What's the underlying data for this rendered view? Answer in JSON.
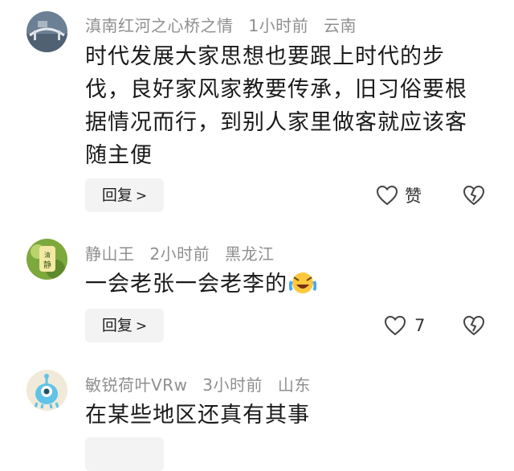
{
  "comments": [
    {
      "user": "滇南红河之心桥之情",
      "time": "1小时前",
      "location": "云南",
      "text": "时代发展大家思想也要跟上时代的步伐，良好家风家教要传承，旧习俗要根据情况而行，到别人家里做客就应该客随主便",
      "reply_label": "回复",
      "like_label": "赞",
      "avatar_icon": "bridge-photo-avatar"
    },
    {
      "user": "静山王",
      "time": "2小时前",
      "location": "黑龙江",
      "text": "一会老张一会老李的",
      "reply_label": "回复",
      "like_label": "7",
      "emoji": "laughing-crying-emoji",
      "avatar_icon": "green-calligraphy-avatar"
    },
    {
      "user": "敏锐荷叶VRw",
      "time": "3小时前",
      "location": "山东",
      "text": "在某些地区还真有其事",
      "avatar_icon": "blue-alien-avatar"
    }
  ],
  "colors": {
    "meta": "#8f8f8f",
    "text": "#1a1a1a",
    "reply_bg": "#f3f3f3"
  }
}
